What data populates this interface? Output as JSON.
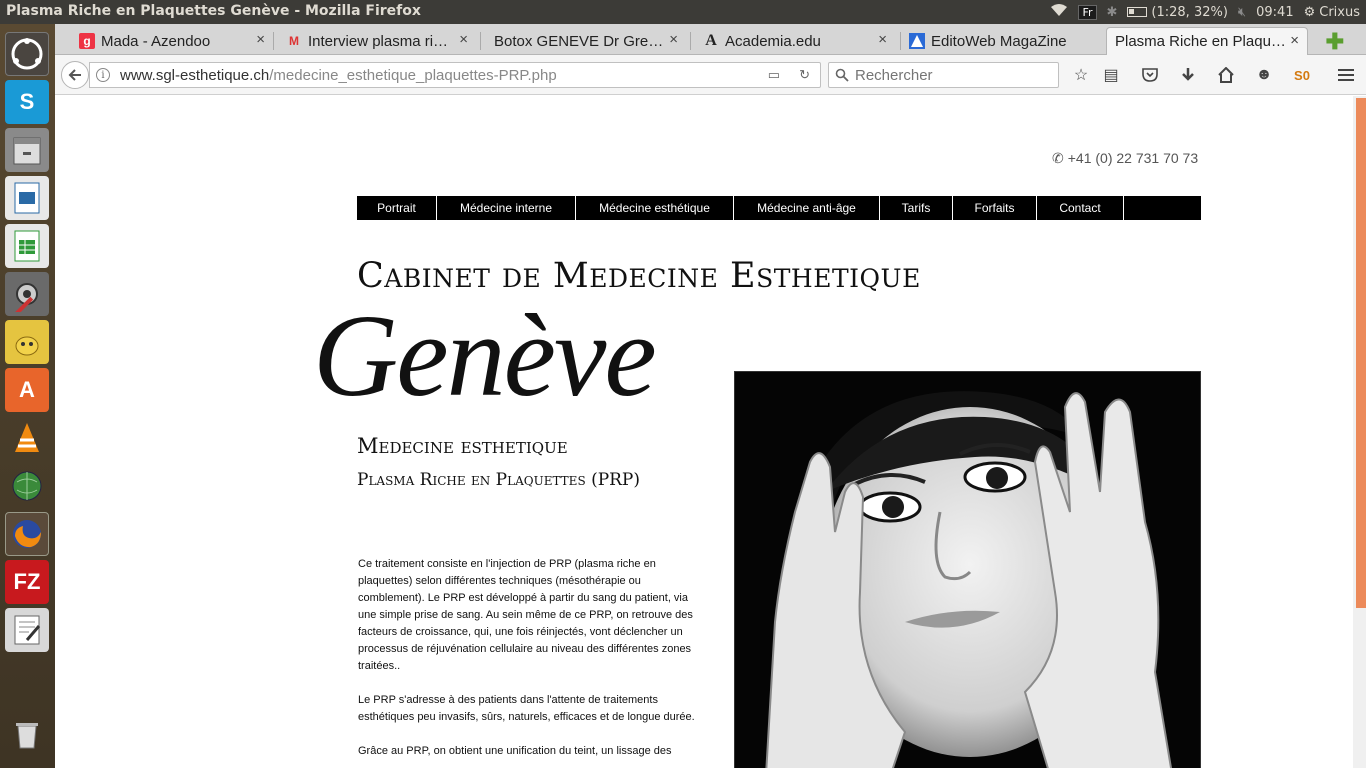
{
  "window": {
    "title": "Plasma Riche en Plaquettes Genève - Mozilla Firefox"
  },
  "tray": {
    "keyboard": "Fr",
    "battery": "(1:28, 32%)",
    "time": "09:41",
    "user": "Crixus"
  },
  "tabs": [
    {
      "label": "Mada - Azendoo",
      "icon": "azendoo-icon"
    },
    {
      "label": "Interview plasma ri…",
      "icon": "gmail-icon"
    },
    {
      "label": "Botox GENEVE Dr Gre…",
      "icon": "page-icon"
    },
    {
      "label": "Academia.edu",
      "icon": "academia-icon"
    },
    {
      "label": "EditoWeb MagaZine",
      "icon": "editoweb-icon"
    },
    {
      "label": "Plasma Riche en Plaqu…",
      "icon": "page-icon"
    }
  ],
  "tab_close": "×",
  "address": {
    "domain": "www.sgl-esthetique.ch",
    "path": "/medecine_esthetique_plaquettes-PRP.php"
  },
  "search": {
    "placeholder": "Rechercher"
  },
  "site": {
    "phone": "+41 (0) 22 731 70 73",
    "menu": [
      "Portrait",
      "Médecine interne",
      "Médecine esthétique",
      "Médecine anti-âge",
      "Tarifs",
      "Forfaits",
      "Contact"
    ],
    "heading": "Cabinet de Medecine Esthetique",
    "city": "Genève",
    "subheading": "Medecine esthetique",
    "subheading2": "Plasma Riche en Plaquettes (PRP)",
    "paragraphs": [
      "Ce traitement consiste en l'injection de PRP (plasma riche en plaquettes) selon différentes techniques (mésothérapie ou comblement). Le PRP est développé à partir du sang du patient, via une simple prise de sang. Au sein même de ce PRP, on retrouve des facteurs de croissance, qui, une fois réinjectés, vont déclencher un processus de réjuvénation cellulaire au niveau des différentes zones traitées..",
      "Le PRP s'adresse à des patients dans l'attente de traitements esthétiques peu invasifs, sûrs, naturels, efficaces et de longue durée.",
      "Grâce au PRP, on obtient une unification du teint, un lissage des"
    ]
  }
}
